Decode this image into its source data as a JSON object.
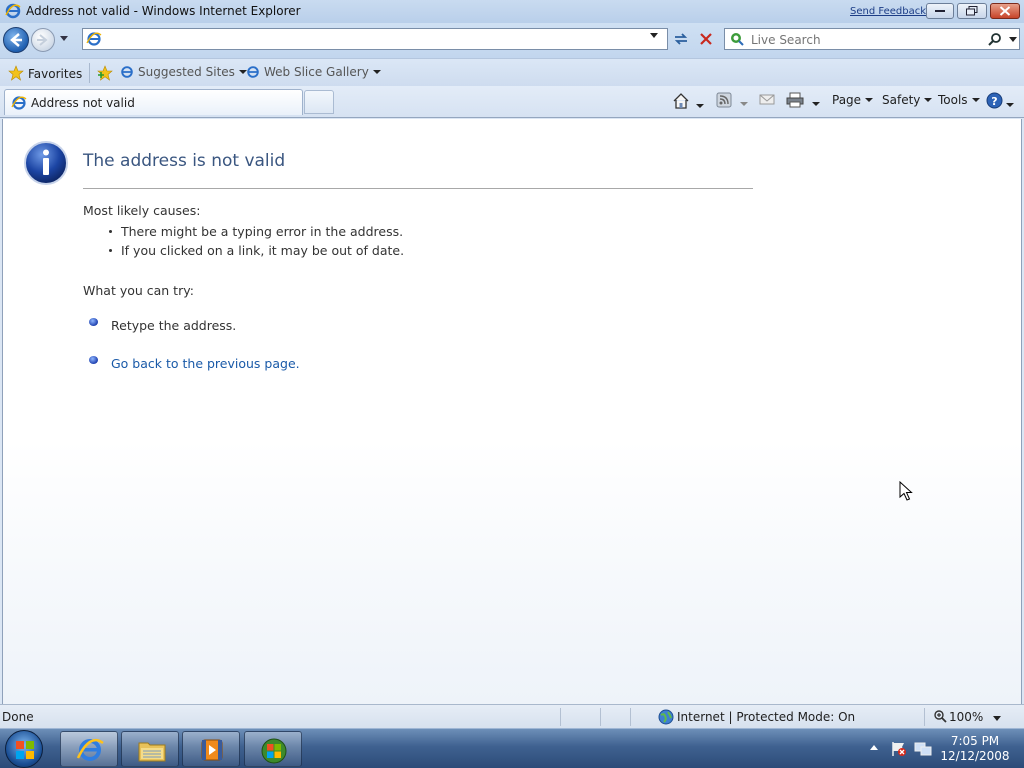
{
  "window": {
    "title": "Address not valid - Windows Internet Explorer",
    "send_feedback": "Send Feedback"
  },
  "address_bar": {
    "value": "",
    "placeholder": ""
  },
  "search": {
    "placeholder": "Live Search"
  },
  "favorites_bar": {
    "favorites_label": "Favorites",
    "items": [
      "Suggested Sites",
      "Web Slice Gallery"
    ]
  },
  "tab": {
    "label": "Address not valid"
  },
  "command_bar": {
    "page": "Page",
    "safety": "Safety",
    "tools": "Tools"
  },
  "content": {
    "title": "The address is not valid",
    "causes_heading": "Most likely causes:",
    "causes": [
      "There might be a typing error in the address.",
      "If you clicked on a link, it may be out of date."
    ],
    "try_heading": "What you can try:",
    "retype": "Retype the address.",
    "go_back": "Go back to the previous page."
  },
  "status_bar": {
    "status": "Done",
    "zone": "Internet | Protected Mode: On",
    "zoom": "100%"
  },
  "taskbar": {
    "apps": [
      "internet-explorer",
      "windows-explorer",
      "media-player",
      "windows"
    ],
    "time": "7:05 PM",
    "date": "12/12/2008"
  },
  "icons": [
    "ie-icon",
    "back-arrow-icon",
    "forward-arrow-icon",
    "refresh-icon",
    "stop-icon",
    "search-icon",
    "star-icon",
    "home-icon",
    "feeds-icon",
    "mail-icon",
    "print-icon",
    "help-icon",
    "info-icon",
    "globe-icon",
    "zoom-icon",
    "windows-logo-icon",
    "folder-icon",
    "media-icon",
    "flag-icon",
    "network-icon"
  ],
  "colors": {
    "link": "#1a5aa8",
    "title": "#3a5680",
    "taskbar": "#2c4b78"
  }
}
